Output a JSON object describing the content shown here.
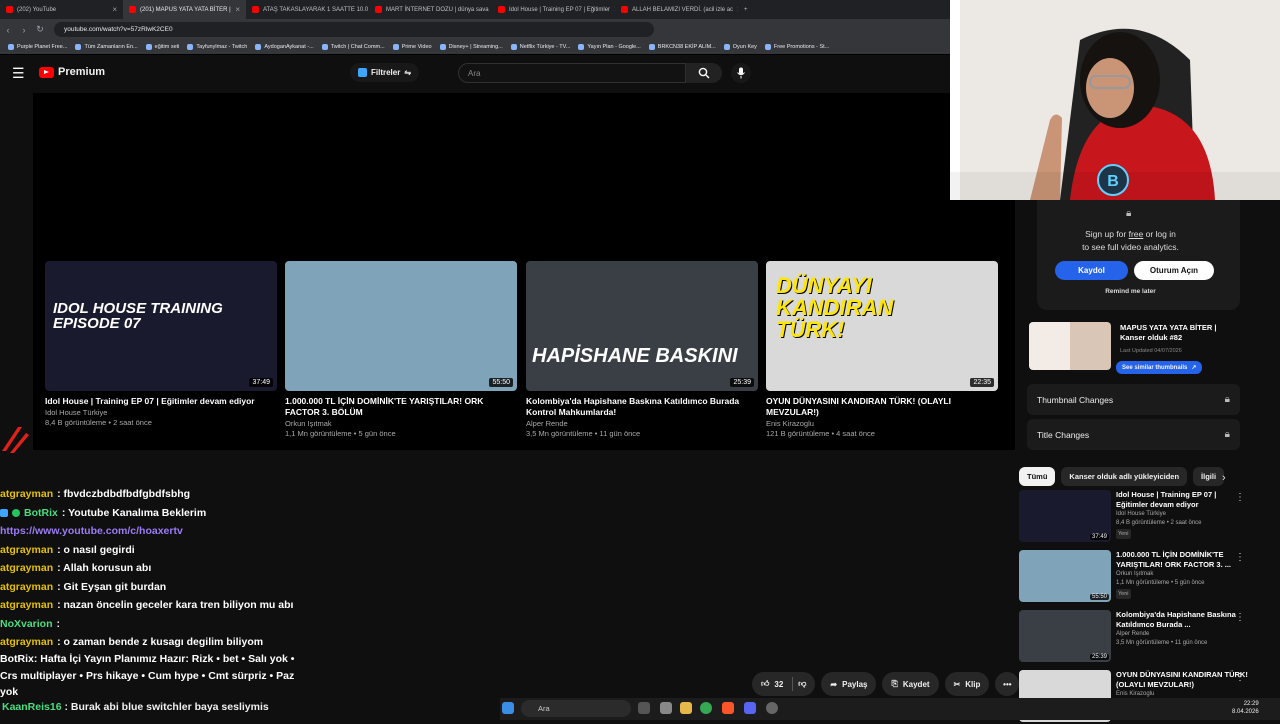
{
  "browser": {
    "tabs": [
      {
        "label": "(202) YouTube",
        "active": false
      },
      {
        "label": "(201) MAPUS YATA YATA BİTER |",
        "active": true
      },
      {
        "label": "ATAŞ TAKASLAYARAK 1 SAATTE 10.0",
        "active": false
      },
      {
        "label": "MART İNTERNET DOZU | dünya sava",
        "active": false
      },
      {
        "label": "Idol House | Training EP 07 | Eğitimler",
        "active": false
      },
      {
        "label": "ALLAH BELAMIZI VERDİ. (acil izle ac",
        "active": false
      }
    ],
    "url": "youtube.com/watch?v=57zRlwK2CE0",
    "bookmarks": [
      "Purple Planet Free...",
      "Tüm Zamanların En...",
      "eğitim seti",
      "Tayfunylmaz - Twitch",
      "AydoganAykanat -...",
      "Twitch | Chat Comm...",
      "Prime Video",
      "Disney+ | Streaming...",
      "Netflix Türkiye - TV...",
      "Yayın Plan - Google...",
      "BRKCN38 EKİP ALIM...",
      "Oyun Key",
      "Free Promotions - St..."
    ]
  },
  "masthead": {
    "logo": "Premium",
    "filters": "Filtreler",
    "search_placeholder": "Ara"
  },
  "endscreen": [
    {
      "title": "Idol House | Training EP 07 | Eğitimler devam ediyor",
      "channel": "Idol House Türkiye",
      "meta": "8,4 B görüntüleme • 2 saat önce",
      "duration": "37:49",
      "overlay": "IDOL HOUSE TRAINING EPISODE 07",
      "color": "#1a1a2e"
    },
    {
      "title": "1.000.000 TL İÇİN DOMİNİK'TE YARIŞTILAR! ORK FACTOR 3. BÖLÜM",
      "channel": "Orkun Işıtmak",
      "meta": "1,1 Mn görüntüleme • 5 gün önce",
      "duration": "55:50",
      "overlay": "",
      "color": "#7fa3b8"
    },
    {
      "title": "Kolombiya'da Hapishane Baskına Katıldımco Burada Kontrol Mahkumlarda!",
      "channel": "Alper Rende",
      "meta": "3,5 Mn görüntüleme • 11 gün önce",
      "duration": "25:39",
      "overlay": "HAPİSHANE BASKINI",
      "color": "#3a3f45"
    },
    {
      "title": "OYUN DÜNYASINI KANDIRAN TÜRK! (OLAYLI MEVZULAR!)",
      "channel": "Enis Kirazoglu",
      "meta": "121 B görüntüleme • 4 saat önce",
      "duration": "22:35",
      "overlay": "DÜNYAYI KANDIRAN TÜRK!",
      "color": "#d9d9d9"
    }
  ],
  "chat": [
    {
      "user": "atgrayman",
      "text": ": fbvdczbdbdfbdfgbdfsbhg",
      "badge": false,
      "bot": false
    },
    {
      "user": "BotRix",
      "text": ": Youtube Kanalıma Beklerim",
      "badge": true,
      "bot": true
    },
    {
      "user": "",
      "text": "https://www.youtube.com/c/hoaxertv",
      "badge": false,
      "bot": false,
      "link": true
    },
    {
      "user": "atgrayman",
      "text": ": o nasıl gegirdi",
      "badge": false,
      "bot": false
    },
    {
      "user": "atgrayman",
      "text": ": Allah korusun abı",
      "badge": false,
      "bot": false
    },
    {
      "user": "atgrayman",
      "text": ": Git Eyşan git burdan",
      "badge": false,
      "bot": false
    },
    {
      "user": "atgrayman",
      "text": ": nazan öncelin geceler kara tren biliyon mu abı",
      "badge": false,
      "bot": false
    },
    {
      "user": "NoXvarion",
      "text": ":",
      "badge": false,
      "bot": true
    },
    {
      "user": "atgrayman",
      "text": ": o zaman bende z kusagı degilim biliyom",
      "badge": false,
      "bot": false
    }
  ],
  "ticker": "BotRix: Hafta İçi Yayın Planımız Hazır: Rizk • bet • Salı yok • Crs multiplayer • Prs hikaye • Cum hype • Cmt sürpriz • Paz yok",
  "chat_last": {
    "user": "KaanReis16",
    "text": ": Burak abi blue switchler baya sesliymis"
  },
  "actions": {
    "likes": "32",
    "share": "Paylaş",
    "save": "Kaydet",
    "clip": "Klip"
  },
  "sidebar": {
    "signup_line1_a": "Sign up for ",
    "signup_free": "free",
    "signup_line1_b": " or log in",
    "signup_line2": "to see full video analytics.",
    "kaydol": "Kaydol",
    "oturum": "Oturum Açın",
    "remind": "Remind me later",
    "current_title": "MAPUS YATA YATA BİTER | Kanser olduk #82",
    "current_updated": "Last Updated 04/07/2026",
    "similar": "See similar thumbnails",
    "thumb_changes": "Thumbnail Changes",
    "title_changes": "Title Changes",
    "chips": [
      "Tümü",
      "Kanser olduk adlı yükleyiciden",
      "İlgili"
    ],
    "recs": [
      {
        "title": "Idol House | Training EP 07 | Eğitimler devam ediyor",
        "channel": "Idol House Türkiye",
        "meta": "8,4 B görüntüleme • 2 saat önce",
        "duration": "37:49",
        "new": "Yeni",
        "color": "#1a1a2e"
      },
      {
        "title": "1.000.000 TL İÇİN DOMİNİK'TE YARIŞTILAR! ORK FACTOR 3. ...",
        "channel": "Orkun Işıtmak",
        "meta": "1,1 Mn görüntüleme • 5 gün önce",
        "duration": "55:50",
        "new": "Yeni",
        "color": "#7fa3b8"
      },
      {
        "title": "Kolombiya'da Hapishane Baskına Katıldımco Burada ...",
        "channel": "Alper Rende",
        "meta": "3,5 Mn görüntüleme • 11 gün önce",
        "duration": "25:39",
        "new": "",
        "color": "#3a3f45"
      },
      {
        "title": "OYUN DÜNYASINI KANDIRAN TÜRK! (OLAYLI MEVZULAR!)",
        "channel": "Enis Kirazoglu",
        "meta": "",
        "duration": "",
        "new": "",
        "color": "#d9d9d9"
      }
    ]
  },
  "taskbar": {
    "search": "Ara",
    "time": "22:29",
    "date": "8.04.2026"
  },
  "colors": {
    "accent": "#ff0000",
    "blue": "#2563eb",
    "chat_user": "#e5c100",
    "bot_user": "#4ade80"
  }
}
